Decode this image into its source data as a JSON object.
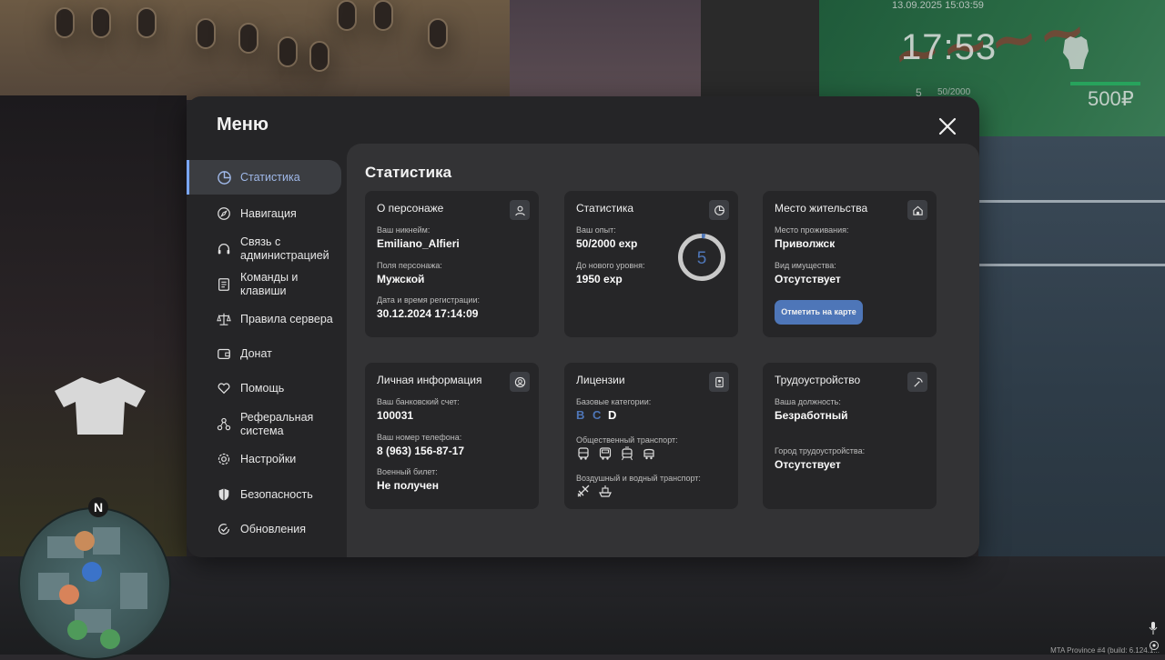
{
  "hud": {
    "datetime": "13.09.2025 15:03:59",
    "clock": "17:53",
    "level": "5",
    "exp": "50/2000",
    "money": "500₽",
    "build": "MTA Province #4 (build: 6.124.1..."
  },
  "menu": {
    "title": "Меню",
    "nav": [
      {
        "label": "Статистика",
        "icon": "pie-chart-icon",
        "active": true
      },
      {
        "label": "Навигация",
        "icon": "compass-icon"
      },
      {
        "label": "Связь с администрацией",
        "icon": "headset-icon"
      },
      {
        "label": "Команды и клавиши",
        "icon": "document-icon"
      },
      {
        "label": "Правила сервера",
        "icon": "scales-icon"
      },
      {
        "label": "Донат",
        "icon": "wallet-icon"
      },
      {
        "label": "Помощь",
        "icon": "hand-heart-icon"
      },
      {
        "label": "Реферальная система",
        "icon": "network-icon"
      },
      {
        "label": "Настройки",
        "icon": "gear-icon"
      },
      {
        "label": "Безопасность",
        "icon": "shield-icon"
      },
      {
        "label": "Обновления",
        "icon": "refresh-icon"
      }
    ]
  },
  "content": {
    "title": "Статистика",
    "character": {
      "title": "О персонаже",
      "nickname_label": "Ваш никнейм:",
      "nickname": "Emiliano_Alfieri",
      "gender_label": "Поля персонажа:",
      "gender": "Мужской",
      "reg_label": "Дата и время регистрации:",
      "reg": "30.12.2024 17:14:09"
    },
    "stats": {
      "title": "Статистика",
      "exp_label": "Ваш опыт:",
      "exp": "50/2000 exp",
      "next_label": "До нового уровня:",
      "next": "1950 exp",
      "level": "5",
      "progress": 0.025,
      "ring_color": "#4e76b8"
    },
    "residence": {
      "title": "Место жительства",
      "place_label": "Место проживания:",
      "place": "Приволжск",
      "property_label": "Вид имущества:",
      "property": "Отсутствует",
      "button": "Отметить на карте"
    },
    "personal": {
      "title": "Личная информация",
      "bank_label": "Ваш банковский счет:",
      "bank": "100031",
      "phone_label": "Ваш номер телефона:",
      "phone": "8 (963) 156-87-17",
      "military_label": "Военный билет:",
      "military": "Не получен"
    },
    "licenses": {
      "title": "Лицензии",
      "base_label": "Базовые категории:",
      "categories": [
        {
          "label": "B",
          "color": "#4e76b8"
        },
        {
          "label": "C",
          "color": "#4e76b8"
        },
        {
          "label": "D",
          "color": "#ffffff"
        }
      ],
      "public_label": "Общественный транспорт:",
      "air_label": "Воздушный и водный транспорт:"
    },
    "employment": {
      "title": "Трудоустройство",
      "position_label": "Ваша должность:",
      "position": "Безработный",
      "city_label": "Город трудоустройства:",
      "city": "Отсутствует"
    }
  }
}
